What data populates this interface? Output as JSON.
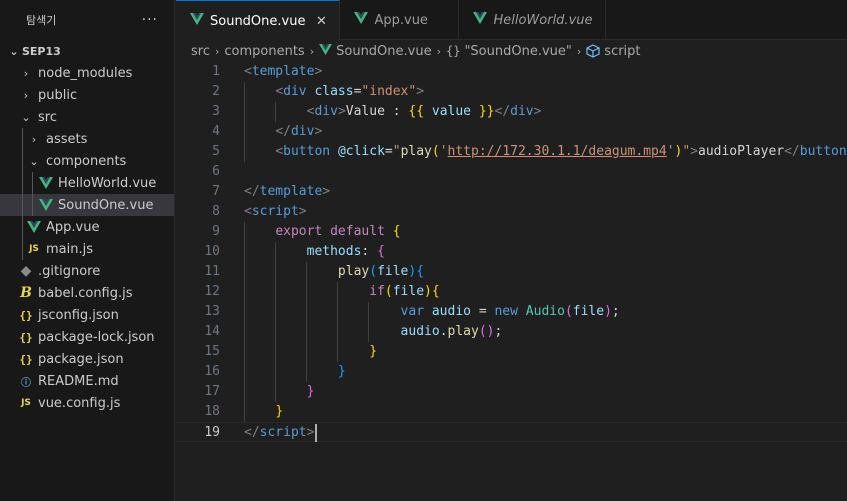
{
  "explorer": {
    "title": "탐색기",
    "more": "···",
    "root": "SEP13",
    "items": [
      {
        "label": "node_modules"
      },
      {
        "label": "public"
      },
      {
        "label": "src"
      },
      {
        "label": "assets"
      },
      {
        "label": "components"
      },
      {
        "label": "HelloWorld.vue"
      },
      {
        "label": "SoundOne.vue"
      },
      {
        "label": "App.vue"
      },
      {
        "label": "main.js",
        "icon_text": "JS"
      },
      {
        "label": ".gitignore",
        "icon_text": "◆"
      },
      {
        "label": "babel.config.js",
        "icon_text": "B"
      },
      {
        "label": "jsconfig.json",
        "icon_text": "{}"
      },
      {
        "label": "package-lock.json",
        "icon_text": "{}"
      },
      {
        "label": "package.json",
        "icon_text": "{}"
      },
      {
        "label": "README.md",
        "icon_text": "ⓘ"
      },
      {
        "label": "vue.config.js",
        "icon_text": "JS"
      }
    ]
  },
  "tabs": [
    {
      "label": "SoundOne.vue",
      "close": "✕"
    },
    {
      "label": "App.vue"
    },
    {
      "label": "HelloWorld.vue"
    }
  ],
  "breadcrumb": {
    "parts": [
      "src",
      "components",
      "SoundOne.vue",
      "\"SoundOne.vue\"",
      "script"
    ],
    "sep": "›",
    "curly": "{}"
  },
  "editor": {
    "line_numbers": [
      "1",
      "2",
      "3",
      "4",
      "5",
      "6",
      "7",
      "8",
      "9",
      "10",
      "11",
      "12",
      "13",
      "14",
      "15",
      "16",
      "17",
      "18",
      "19"
    ],
    "code": {
      "l1": [
        "<",
        "template",
        ">"
      ],
      "l2": [
        "<",
        "div",
        " ",
        "class",
        "=",
        "\"index\"",
        ">"
      ],
      "l3": [
        "<",
        "div",
        ">",
        "Value : ",
        "{{",
        " value ",
        "}}",
        "</",
        "div",
        ">"
      ],
      "l4": [
        "</",
        "div",
        ">"
      ],
      "l5": [
        "<",
        "button",
        " ",
        "@click",
        "=",
        "\"",
        "play",
        "(",
        "'",
        "http://172.30.1.1/deagum.mp4",
        "'",
        ")",
        "\"",
        ">",
        "audioPlayer",
        "</",
        "button",
        ">"
      ],
      "l7": [
        "</",
        "template",
        ">"
      ],
      "l8": [
        "<",
        "script",
        ">"
      ],
      "l9": [
        "export",
        " ",
        "default",
        " ",
        "{"
      ],
      "l10": [
        "methods",
        ": ",
        "{"
      ],
      "l11": [
        "play",
        "(",
        "file",
        ")",
        "{"
      ],
      "l12": [
        "if",
        "(",
        "file",
        ")",
        "{"
      ],
      "l13": [
        "var",
        " ",
        "audio",
        " = ",
        "new",
        " ",
        "Audio",
        "(",
        "file",
        ")",
        ";"
      ],
      "l14": [
        "audio",
        ".",
        "play",
        "(",
        ")",
        ";"
      ],
      "l15": [
        "}"
      ],
      "l16": [
        "}"
      ],
      "l17": [
        "}"
      ],
      "l18": [
        "}"
      ],
      "l19": [
        "</",
        "script",
        ">"
      ]
    }
  },
  "colors": {
    "vue_green": "#41b883",
    "accent": "#0078d4"
  }
}
